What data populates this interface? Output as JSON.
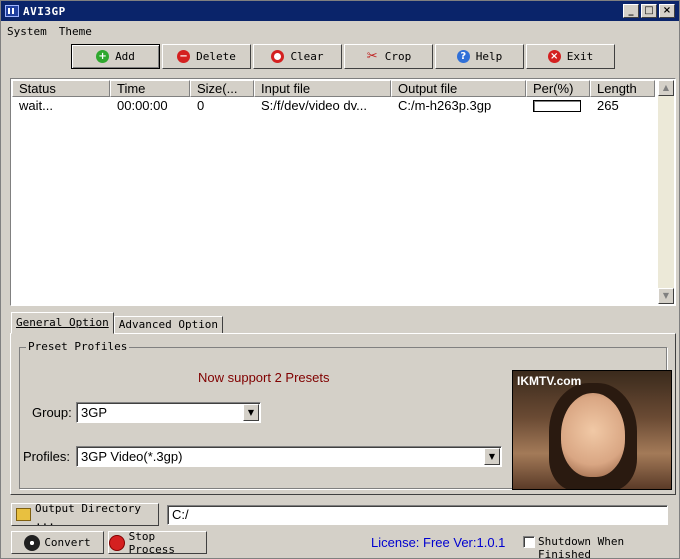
{
  "window": {
    "title": "AVI3GP"
  },
  "title_buttons": {
    "minimize": "_",
    "maximize": "□",
    "close": "×"
  },
  "menu": [
    {
      "label": "System"
    },
    {
      "label": "Theme"
    }
  ],
  "toolbar": {
    "buttons": [
      {
        "label": "Add",
        "icon": "plus-icon"
      },
      {
        "label": "Delete",
        "icon": "minus-icon"
      },
      {
        "label": "Clear",
        "icon": "ring-icon"
      },
      {
        "label": "Crop",
        "icon": "scissors-icon"
      },
      {
        "label": "Help",
        "icon": "question-icon"
      },
      {
        "label": "Exit",
        "icon": "x-icon"
      }
    ]
  },
  "file_list": {
    "columns": [
      "Status",
      "Time",
      "Size(...",
      "Input file",
      "Output file",
      "Per(%)",
      "Length"
    ],
    "rows": [
      {
        "status": "wait...",
        "time": "00:00:00",
        "size": "0",
        "input": "S:/f/dev/video dv...",
        "output": "C:/m-h263p.3gp",
        "percent": 0,
        "length": "265"
      }
    ]
  },
  "tabs": [
    {
      "label": "General Option",
      "active": true
    },
    {
      "label": "Advanced Option",
      "active": false
    }
  ],
  "presets": {
    "title": "Preset Profiles",
    "message": "Now support 2 Presets",
    "group_label": "Group:",
    "group_value": "3GP",
    "profiles_label": "Profiles:",
    "profiles_value": "3GP Video(*.3gp)",
    "preview_logo": "IKMTV.com"
  },
  "output": {
    "button_label": "Output Directory ...",
    "path": "C:/"
  },
  "actions": {
    "convert_label": "Convert",
    "stop_label": "Stop Process"
  },
  "status": {
    "license": "License: Free Ver:1.0.1",
    "shutdown_label": "Shutdown When Finished",
    "shutdown_checked": false
  },
  "colors": {
    "titlebar": "#0a246a",
    "face": "#d4d0c8",
    "license_text": "#0000d0",
    "preset_message": "#800000"
  }
}
